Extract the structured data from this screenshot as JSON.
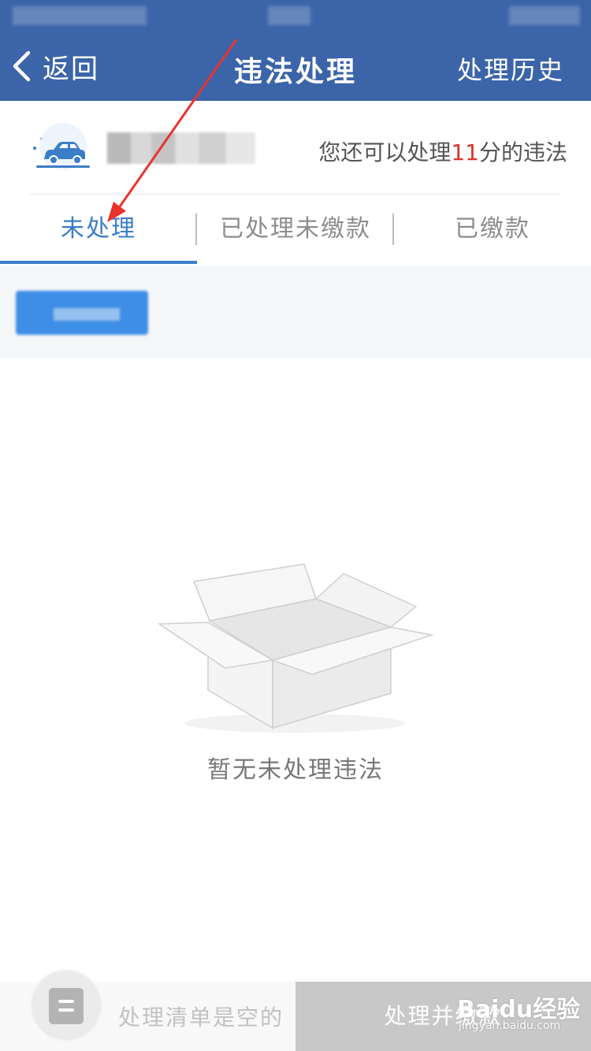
{
  "nav": {
    "back_label": "返回",
    "title": "违法处理",
    "history_label": "处理历史"
  },
  "vehicle": {
    "points_prefix": "您还可以处理",
    "points_value": "11",
    "points_suffix": "分的违法"
  },
  "tabs": [
    {
      "label": "未处理",
      "active": true
    },
    {
      "label": "已处理未缴款",
      "active": false
    },
    {
      "label": "已缴款",
      "active": false
    }
  ],
  "empty_state": {
    "text": "暂无未处理违法"
  },
  "bottom_bar": {
    "cart_text": "处理清单是空的",
    "pay_label": "处理并缴款"
  },
  "watermark": {
    "logo_text": "Baidu经验",
    "url_text": "jingyan.baidu.com"
  },
  "colors": {
    "nav_bg": "#3b64a9",
    "accent": "#3c7dc8",
    "points_highlight": "#d9332e",
    "arrow": "#e8332d"
  }
}
